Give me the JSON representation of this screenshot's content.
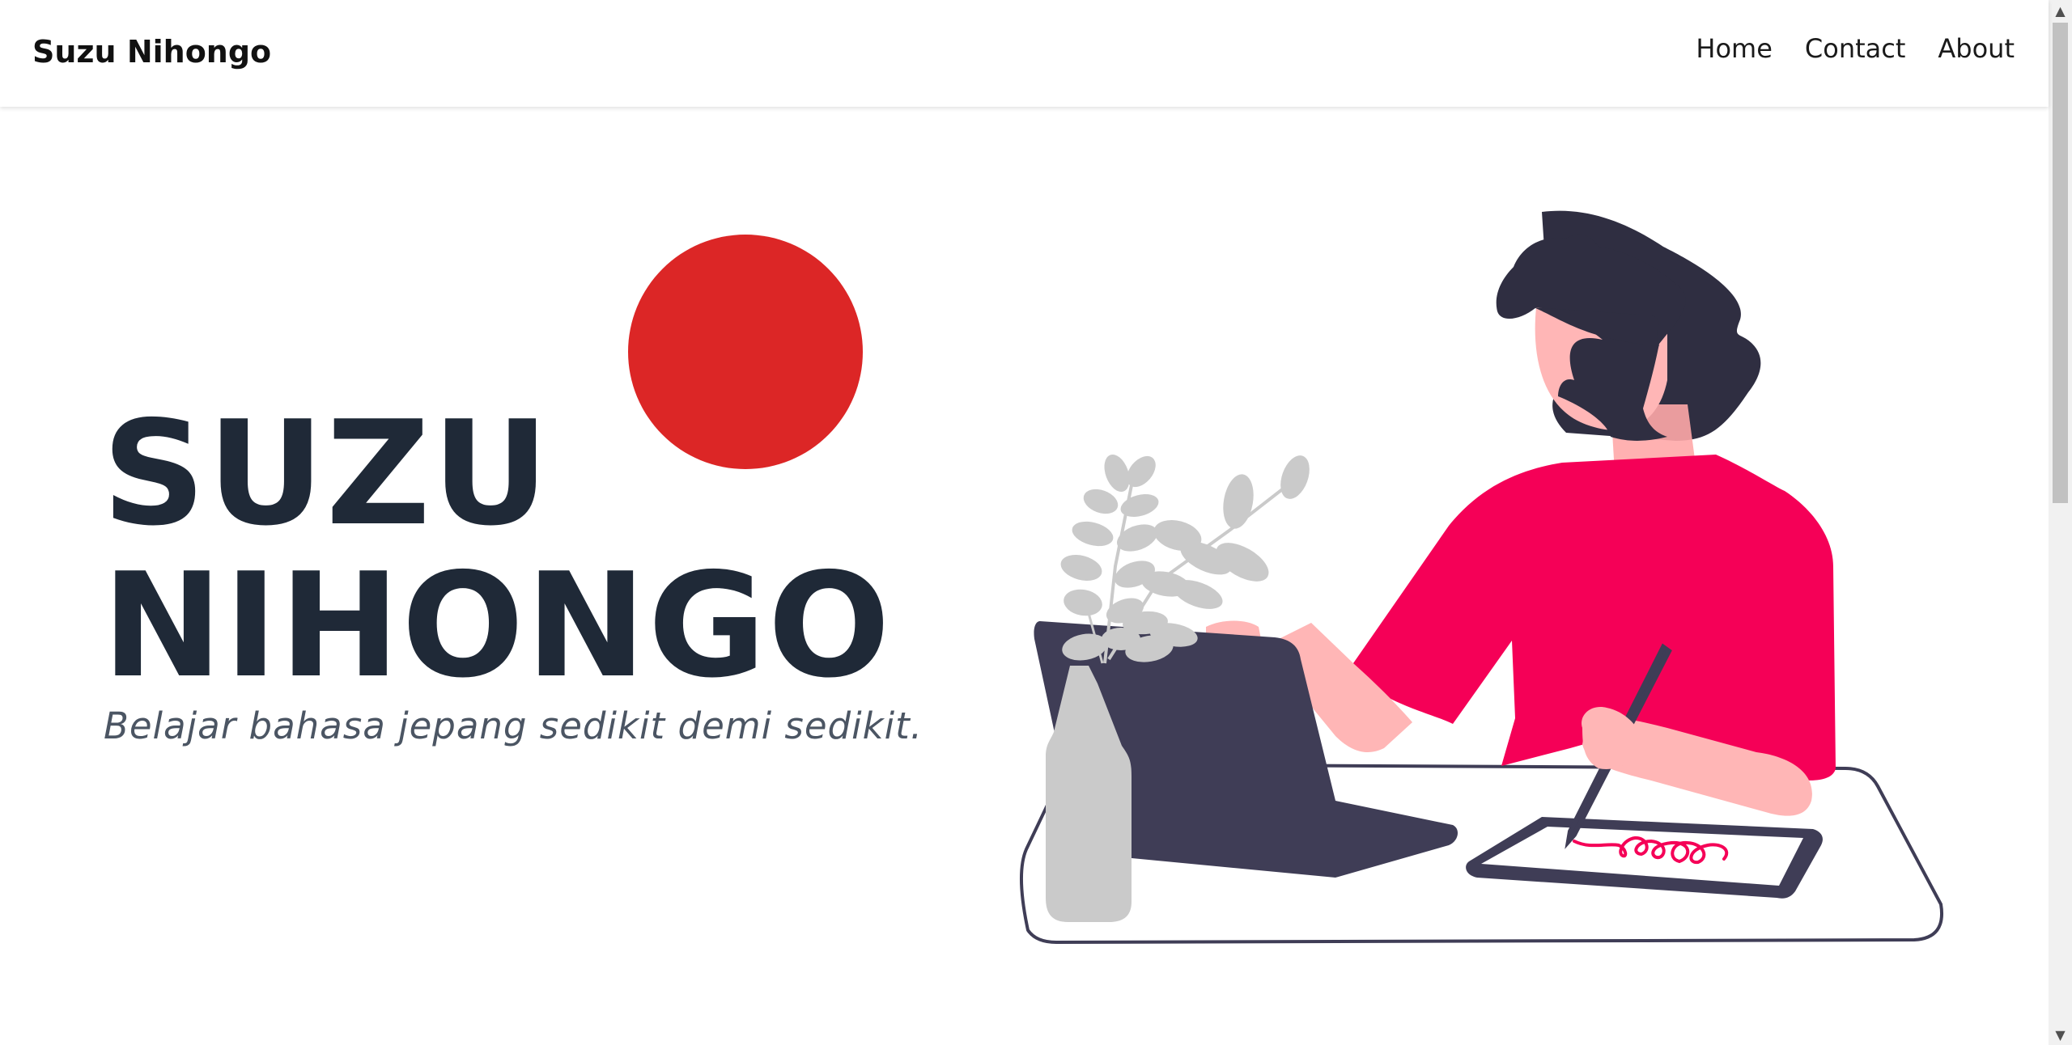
{
  "navbar": {
    "brand": "Suzu Nihongo",
    "links": [
      {
        "label": "Home"
      },
      {
        "label": "Contact"
      },
      {
        "label": "About"
      }
    ]
  },
  "hero": {
    "title_line1": "SUZU",
    "title_line2": "NIHONGO",
    "subtitle": "Belajar bahasa jepang sedikit demi sedikit."
  },
  "colors": {
    "sun": "#dc2626",
    "title": "#1f2937",
    "subtitle": "#4b5563",
    "shirt": "#f50057",
    "hair": "#2f2e41",
    "skin": "#ffb6b6",
    "laptop": "#3f3d56",
    "plant": "#cacaca"
  },
  "icons": {
    "scroll_up": "triangle-up-icon",
    "scroll_down": "triangle-down-icon"
  }
}
